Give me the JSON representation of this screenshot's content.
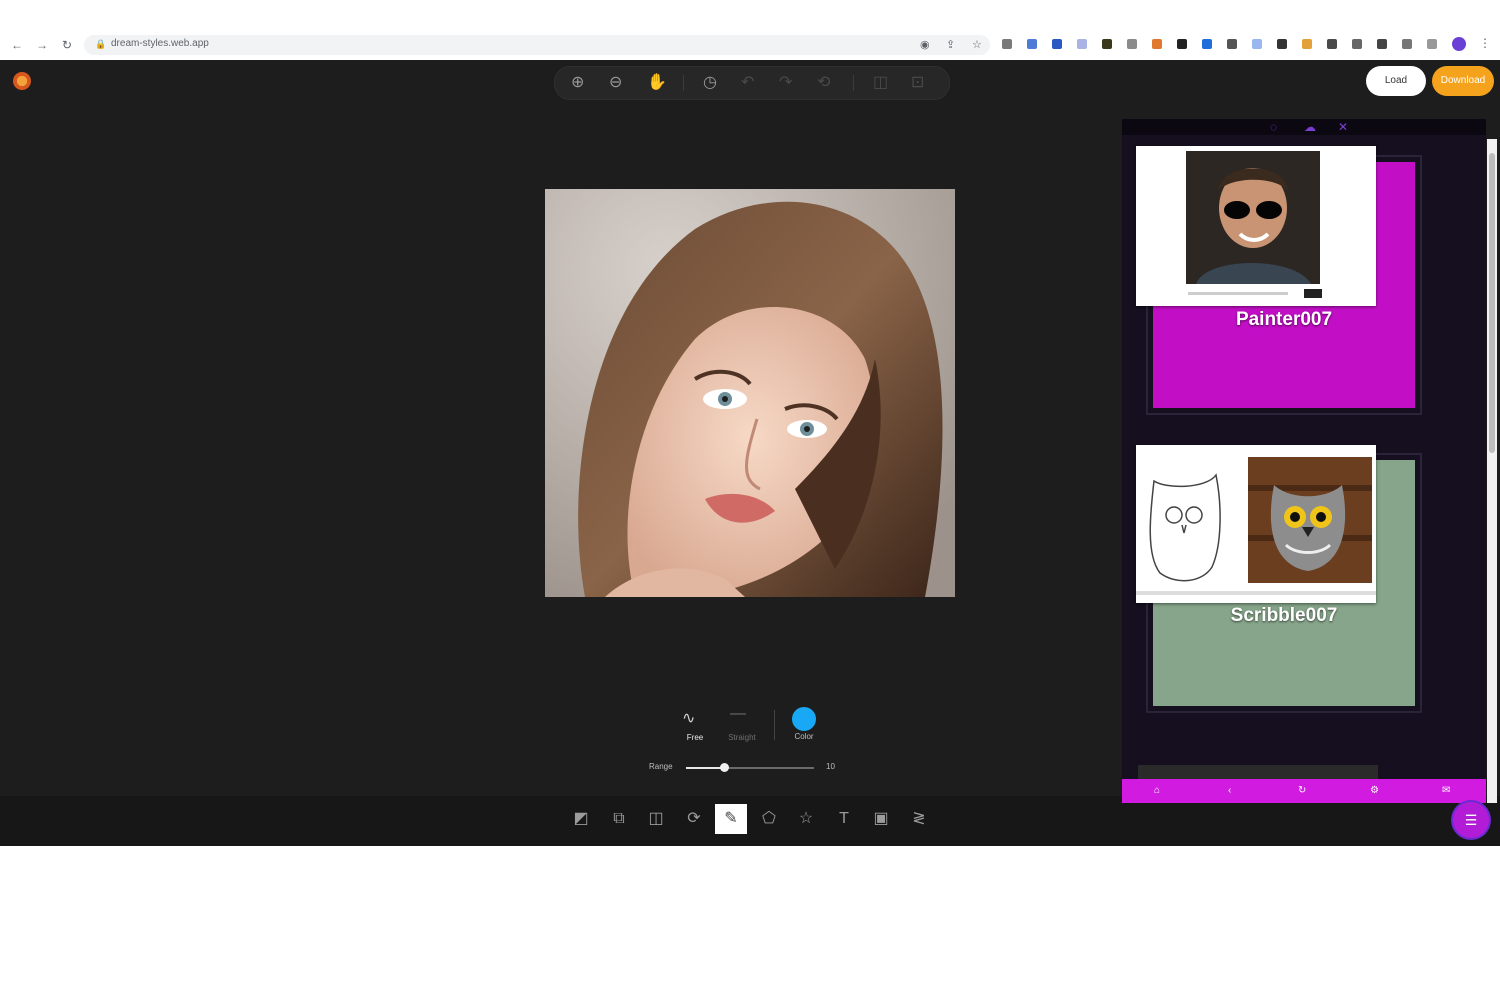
{
  "browser": {
    "url": "dream-styles.web.app",
    "nav_icons": [
      "back-icon",
      "forward-icon",
      "reload-icon"
    ],
    "back_glyph": "←",
    "forward_glyph": "→",
    "reload_glyph": "↻",
    "lock_glyph": "🔒",
    "menu_glyph": "⋮"
  },
  "toolbar": {
    "zoom_in_glyph": "⊕",
    "zoom_out_glyph": "⊖",
    "pan_glyph": "✋",
    "history_glyph": "◷",
    "undo_glyph": "↶",
    "redo_glyph": "↷",
    "reset_glyph": "⟲",
    "compare_glyph": "◫",
    "fit_glyph": "⊡"
  },
  "header": {
    "load_label": "Load",
    "download_label": "Download"
  },
  "brush": {
    "free_label": "Free",
    "straight_label": "Straight",
    "color_label": "Color",
    "size_label": "Range",
    "size_value": "10",
    "size_fraction": 0.3,
    "color": "#18a8f5"
  },
  "bottom_tools": [
    {
      "name": "filter-tool-icon",
      "glyph": "◩"
    },
    {
      "name": "crop-tool-icon",
      "glyph": "⧉"
    },
    {
      "name": "flip-tool-icon",
      "glyph": "◫"
    },
    {
      "name": "rotate-tool-icon",
      "glyph": "⟳"
    },
    {
      "name": "draw-tool-icon",
      "glyph": "✎",
      "active": true
    },
    {
      "name": "shape-tool-icon",
      "glyph": "⬠"
    },
    {
      "name": "icon-tool-icon",
      "glyph": "☆"
    },
    {
      "name": "text-tool-icon",
      "glyph": "T"
    },
    {
      "name": "mask-tool-icon",
      "glyph": "▣"
    },
    {
      "name": "adjust-tool-icon",
      "glyph": "≷"
    }
  ],
  "panel": {
    "header_icons": [
      "eye-off-icon",
      "cloud-icon",
      "close-icon"
    ],
    "eye_glyph": "◌",
    "cloud_glyph": "☁",
    "close_glyph": "✕",
    "cards": [
      {
        "title": "Painter007",
        "color": "#c20fc6"
      },
      {
        "title": "Scribble007",
        "color": "#86a58a"
      }
    ],
    "nav_icons": [
      "home-icon",
      "back-icon",
      "refresh-icon",
      "settings-icon",
      "mail-icon"
    ],
    "home_glyph": "⌂",
    "back_glyph": "‹",
    "refresh_glyph": "↻",
    "settings_glyph": "⚙",
    "mail_glyph": "✉"
  },
  "fab_glyph": "☰",
  "colors": {
    "app_bg": "#1d1d1d",
    "accent_orange": "#f5a31d",
    "panel_nav": "#d21be0"
  }
}
